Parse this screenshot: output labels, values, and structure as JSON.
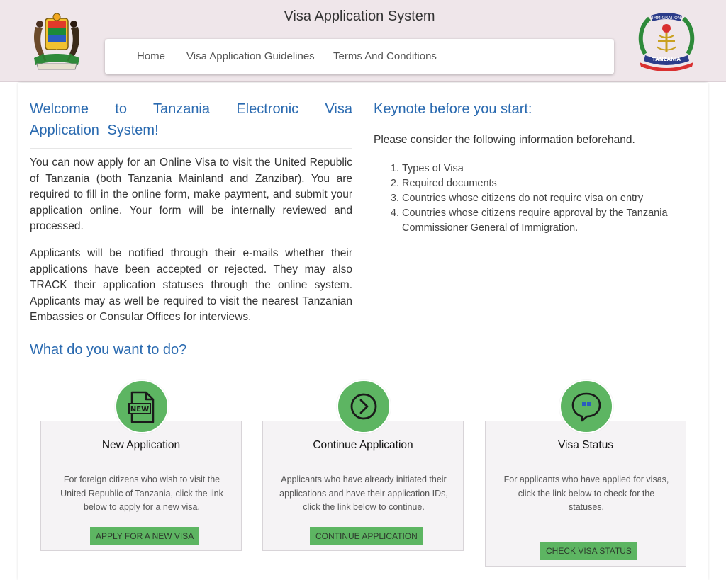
{
  "header": {
    "site_title": "Visa Application System",
    "nav": [
      {
        "label": "Home"
      },
      {
        "label": "Visa Application Guidelines"
      },
      {
        "label": "Terms And Conditions"
      }
    ],
    "right_emblem_text_top": "IMMIGRATION",
    "right_emblem_text_bottom": "TANZANIA"
  },
  "welcome": {
    "title": "Welcome to Tanzania Electronic Visa Application System!",
    "paragraphs": [
      "You can now apply for an Online Visa to visit the United Republic of Tanzania (both Tanzania Mainland and Zanzibar). You are required to fill in the online form, make payment, and submit your application online. Your form will be internally reviewed and processed.",
      "Applicants will be notified through their e-mails whether their applications have been accepted or rejected. They may also TRACK their application statuses through the online system. Applicants may as well be required to visit the nearest Tanzanian Embassies or Consular Offices for interviews."
    ]
  },
  "keynote": {
    "title": "Keynote before you start:",
    "intro": "Please consider the following information beforehand.",
    "items": [
      "Types of Visa",
      "Required documents",
      "Countries whose citizens do not require visa on entry",
      "Countries whose citizens require approval by the Tanzania Commissioner General of Immigration."
    ]
  },
  "actions": {
    "title": "What do you want to do?",
    "cards": [
      {
        "icon": "new-document-icon",
        "icon_text": "NEW",
        "title": "New Application",
        "description": "For foreign citizens who wish to visit the United Republic of Tanzania, click the link below to apply for a new visa.",
        "button": "APPLY FOR A NEW VISA"
      },
      {
        "icon": "arrow-circle-right-icon",
        "title": "Continue Application",
        "description": "Applicants who have already initiated their applications and have their application IDs, click the link below to continue.",
        "button": "CONTINUE APPLICATION"
      },
      {
        "icon": "chat-bubble-icon",
        "title": "Visa Status",
        "description": "For applicants who have applied for visas, click the link below to check for the statuses.",
        "button": "CHECK VISA STATUS"
      }
    ]
  },
  "colors": {
    "header_bg": "#efe6ea",
    "heading_blue": "#2a6ab0",
    "accent_green": "#5db562",
    "card_bg": "#f5f3f5"
  }
}
